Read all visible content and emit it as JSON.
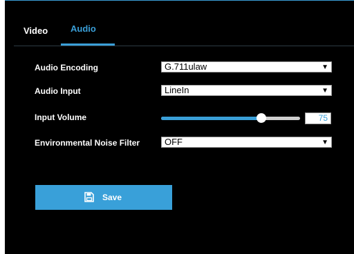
{
  "tabs": [
    {
      "label": "Video",
      "active": false
    },
    {
      "label": "Audio",
      "active": true
    }
  ],
  "fields": {
    "audio_encoding": {
      "label": "Audio Encoding",
      "value": "G.711ulaw"
    },
    "audio_input": {
      "label": "Audio Input",
      "value": "LineIn"
    },
    "input_volume": {
      "label": "Input Volume",
      "value": "75",
      "level": 0.72
    },
    "noise_filter": {
      "label": "Environmental Noise Filter",
      "value": "OFF"
    }
  },
  "actions": {
    "save_label": "Save",
    "save_icon": "floppy-disk-icon"
  },
  "colors": {
    "accent": "#3a9fd8",
    "background": "#000000"
  }
}
